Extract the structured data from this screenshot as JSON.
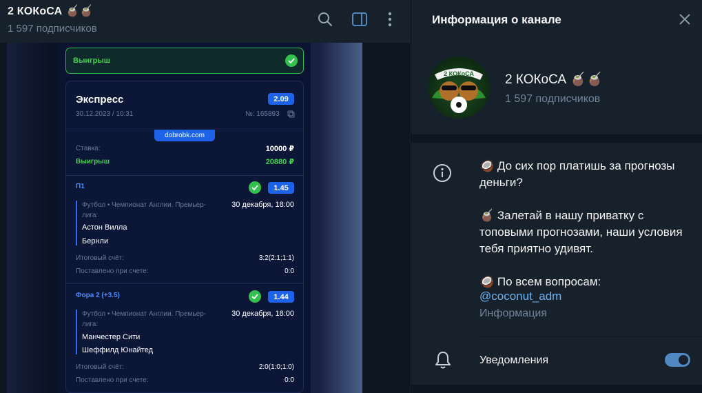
{
  "chat": {
    "title": "2 КОКоСА 🧉🧉",
    "subtitle": "1 597 подписчиков"
  },
  "bet": {
    "win_banner": "Выигрыш",
    "type": "Экспресс",
    "odds_total": "2.09",
    "datetime": "30.12.2023 / 10:31",
    "number": "№: 165893",
    "watermark": "dobrobk.com",
    "stake_label": "Ставка:",
    "stake_value": "10000 ₽",
    "win_label": "Выигрыш",
    "win_value": "20880 ₽",
    "final_score_label": "Итоговый счёт:",
    "placed_at_label": "Поставлено при счете:",
    "events": [
      {
        "market": "П1",
        "odds": "1.45",
        "league_line1": "Футбол • Чемпионат Англии. Премьер-",
        "league_line2": "лига:",
        "date": "30 декабря, 18:00",
        "team1": "Астон Вилла",
        "team2": "Бернли",
        "final_score": "3:2(2:1;1:1)",
        "placed_at": "0:0"
      },
      {
        "market": "Фора 2 (+3.5)",
        "odds": "1.44",
        "league_line1": "Футбол • Чемпионат Англии. Премьер-",
        "league_line2": "лига:",
        "date": "30 декабря, 18:00",
        "team1": "Манчестер Сити",
        "team2": "Шеффилд Юнайтед",
        "final_score": "2:0(1:0;1:0)",
        "placed_at": "0:0"
      }
    ]
  },
  "info": {
    "title": "Информация о канале",
    "name": "2 КОКоСА 🧉🧉",
    "subscribers": "1 597 подписчиков",
    "avatar_text": "2 КОКоСА",
    "description": "🥥 До сих пор платишь за прогнозы деньги?\n\n🧉 Залетай в нашу приватку с топовыми прогнозами, наши условия тебя приятно удивят.\n\n🥥 По всем вопросам:",
    "link": "@coconut_adm",
    "caption": "Информация",
    "notifications_label": "Уведомления",
    "notifications_on": true
  },
  "icons": [
    "search-icon",
    "sidebar-toggle-icon",
    "more-vertical-icon",
    "close-icon",
    "info-icon",
    "bell-icon",
    "copy-icon",
    "check-icon"
  ],
  "colors": {
    "accent": "#5288c1",
    "link": "#6ab3f3",
    "win_green": "#33c24d",
    "odds_blue": "#1d63e8"
  }
}
